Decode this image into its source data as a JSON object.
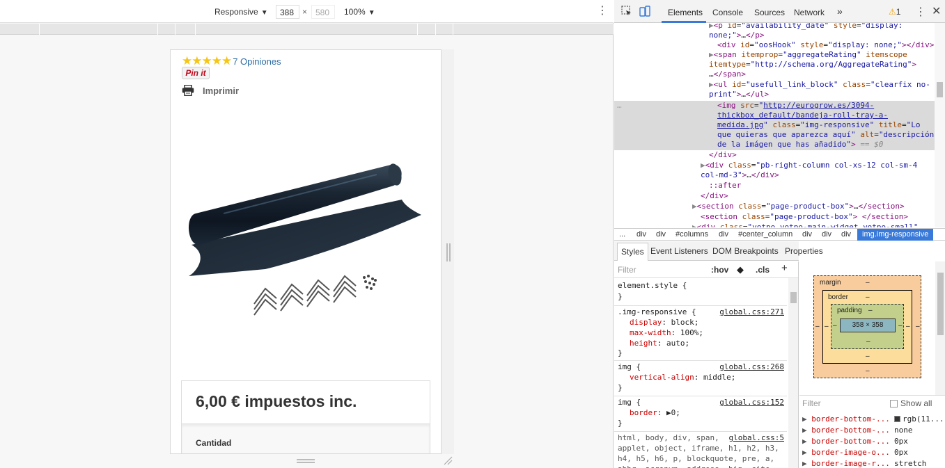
{
  "device_toolbar": {
    "mode": "Responsive",
    "width": "388",
    "times": "×",
    "height": "580",
    "zoom": "100%"
  },
  "product_page": {
    "stars": "★★★★★",
    "opinions": "7 Opiniones",
    "pinit": "Pin it",
    "print_label": "Imprimir",
    "price": "6,00 € impuestos inc.",
    "quantity_label": "Cantidad"
  },
  "devtools": {
    "tabs": [
      "Elements",
      "Console",
      "Sources",
      "Network"
    ],
    "active_tab": "Elements",
    "more_tabs": "»",
    "warning_count": "1",
    "breadcrumbs": [
      "...",
      "div",
      "div",
      "#columns",
      "div",
      "#center_column",
      "div",
      "div",
      "div",
      "img.img-responsive"
    ],
    "pane_tabs": [
      "Styles",
      "Event Listeners",
      "DOM Breakpoints",
      "Properties"
    ],
    "styles_filter_placeholder": "Filter",
    "hov": ":hov",
    "cls": ".cls",
    "plus": "+",
    "box_model": {
      "margin_label": "margin",
      "border_label": "border",
      "padding_label": "padding",
      "dash": "–",
      "content": "358 × 358"
    },
    "computed_filter_placeholder": "Filter",
    "show_all": "Show all",
    "computed": [
      {
        "name": "border-bottom-...",
        "value": "rgb(11..."
      },
      {
        "name": "border-bottom-...",
        "value": "none"
      },
      {
        "name": "border-bottom-...",
        "value": "0px"
      },
      {
        "name": "border-image-o...",
        "value": "0px"
      },
      {
        "name": "border-image-r...",
        "value": "stretch"
      }
    ]
  },
  "colors": {
    "accent": "#3879d9",
    "star": "#f5c518",
    "link": "#2e6ca4",
    "margin": "#f9cc9d",
    "border": "#fddd9b",
    "padding": "#c3d08b",
    "content": "#8cb6c0"
  }
}
